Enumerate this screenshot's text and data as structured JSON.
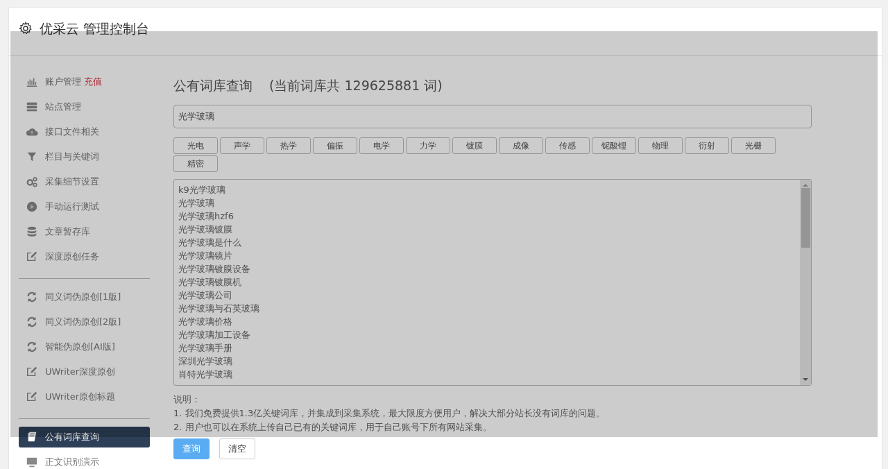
{
  "header": {
    "title": "优采云 管理控制台"
  },
  "sidebar": {
    "sections": [
      [
        {
          "label": "账户管理",
          "badge": "充值",
          "selected": false
        },
        {
          "label": "站点管理",
          "selected": false
        },
        {
          "label": "接口文件相关",
          "selected": false
        },
        {
          "label": "栏目与关键词",
          "selected": false
        },
        {
          "label": "采集细节设置",
          "selected": false
        },
        {
          "label": "手动运行测试",
          "selected": false
        },
        {
          "label": "文章暂存库",
          "selected": false
        },
        {
          "label": "深度原创任务",
          "selected": false
        }
      ],
      [
        {
          "label": "同义词伪原创[1版]",
          "selected": false
        },
        {
          "label": "同义词伪原创[2版]",
          "selected": false
        },
        {
          "label": "智能伪原创[AI版]",
          "selected": false
        },
        {
          "label": "UWriter深度原创",
          "selected": false
        },
        {
          "label": "UWriter原创标题",
          "selected": false
        }
      ],
      [
        {
          "label": "公有词库查询",
          "selected": true
        },
        {
          "label": "正文识别演示",
          "selected": false
        }
      ]
    ]
  },
  "main": {
    "title": "公有词库查询",
    "subtitle": "(当前词库共 129625881 词)",
    "search": {
      "value": "光学玻璃"
    },
    "tags": [
      "光电",
      "声学",
      "热学",
      "偏振",
      "电学",
      "力学",
      "镀膜",
      "成像",
      "传感",
      "铌酸锂",
      "物理",
      "衍射",
      "光栅",
      "精密"
    ],
    "results": [
      "k9光学玻璃",
      "光学玻璃",
      "光学玻璃hzf6",
      "光学玻璃镀膜",
      "光学玻璃是什么",
      "光学玻璃镜片",
      "光学玻璃镀膜设备",
      "光学玻璃镀膜机",
      "光学玻璃公司",
      "光学玻璃与石英玻璃",
      "光学玻璃价格",
      "光学玻璃加工设备",
      "光学玻璃手册",
      "深圳光学玻璃",
      "肖特光学玻璃"
    ],
    "notes_title": "说明：",
    "notes": [
      "1. 我们免费提供1.3亿关键词库，并集成到采集系统，最大限度方便用户，解决大部分站长没有词库的问题。",
      "2. 用户也可以在系统上传自己已有的关键词库，用于自己账号下所有网站采集。"
    ],
    "buttons": [
      {
        "label": "查询",
        "kind": "primary"
      },
      {
        "label": "清空",
        "kind": "default"
      }
    ]
  }
}
